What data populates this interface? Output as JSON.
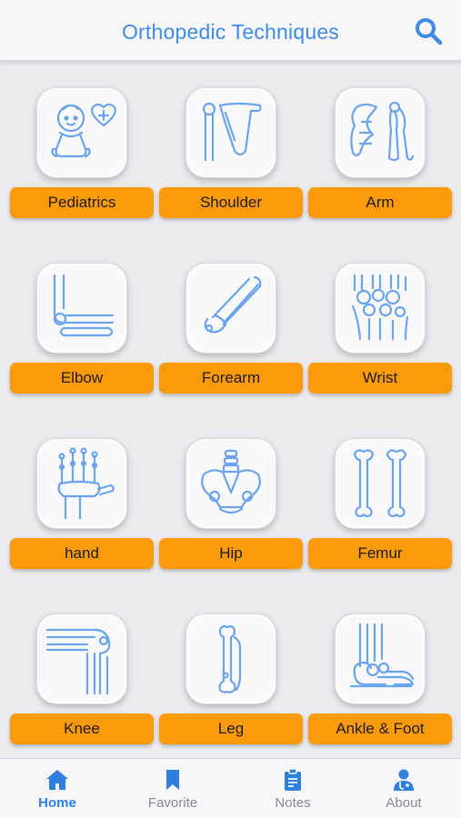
{
  "header": {
    "title": "Orthopedic Techniques",
    "search_icon": "search-icon"
  },
  "categories": [
    {
      "label": "Pediatrics",
      "icon": "baby-icon"
    },
    {
      "label": "Shoulder",
      "icon": "shoulder-bone-icon"
    },
    {
      "label": "Arm",
      "icon": "arm-bone-icon"
    },
    {
      "label": "Elbow",
      "icon": "elbow-bone-icon"
    },
    {
      "label": "Forearm",
      "icon": "forearm-bone-icon"
    },
    {
      "label": "Wrist",
      "icon": "wrist-bone-icon"
    },
    {
      "label": "hand",
      "icon": "hand-bone-icon"
    },
    {
      "label": "Hip",
      "icon": "pelvis-icon"
    },
    {
      "label": "Femur",
      "icon": "femur-icon"
    },
    {
      "label": "Knee",
      "icon": "knee-bone-icon"
    },
    {
      "label": "Leg",
      "icon": "leg-bone-icon"
    },
    {
      "label": "Ankle & Foot",
      "icon": "foot-bone-icon"
    }
  ],
  "tabs": [
    {
      "label": "Home",
      "icon": "home-icon",
      "active": true
    },
    {
      "label": "Favorite",
      "icon": "bookmark-icon",
      "active": false
    },
    {
      "label": "Notes",
      "icon": "clipboard-icon",
      "active": false
    },
    {
      "label": "About",
      "icon": "doctor-icon",
      "active": false
    }
  ],
  "colors": {
    "accent_blue": "#3d8be6",
    "label_orange": "#fb9a0a",
    "icon_stroke": "#6aa3ee",
    "tab_inactive": "#8a8a8e"
  }
}
